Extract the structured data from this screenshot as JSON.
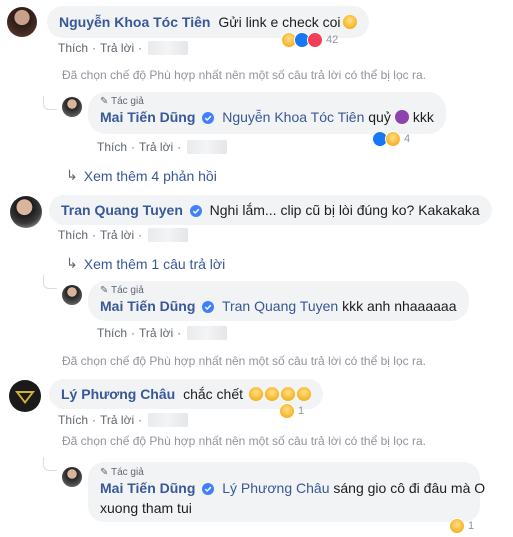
{
  "comments": [
    {
      "author": "Nguyễn Khoa Tóc Tiên",
      "text": "Gửi link e check coi",
      "actions": {
        "like": "Thích",
        "reply": "Trả lời"
      },
      "reaction_count": "42"
    },
    {
      "author": "Tran Quang Tuyen",
      "text": "Nghi lắm... clip cũ bị lòi đúng ko? Kakakaka",
      "actions": {
        "like": "Thích",
        "reply": "Trả lời"
      }
    },
    {
      "author": "Lý Phương Châu",
      "text": "chắc chết",
      "actions": {
        "like": "Thích",
        "reply": "Trả lời"
      },
      "reaction_count": "1"
    }
  ],
  "replies": [
    {
      "badge": "Tác giả",
      "author": "Mai Tiến Dũng",
      "mention": "Nguyễn Khoa Tóc Tiên",
      "text_before_icon": "quỷ",
      "text_after_icon": "kkk",
      "actions": {
        "like": "Thích",
        "reply": "Trả lời"
      },
      "reaction_count": "4"
    },
    {
      "badge": "Tác giả",
      "author": "Mai Tiến Dũng",
      "mention": "Tran Quang Tuyen",
      "text": "kkk anh nhaaaaaa",
      "actions": {
        "like": "Thích",
        "reply": "Trả lời"
      }
    },
    {
      "badge": "Tác giả",
      "author": "Mai Tiến Dũng",
      "mention": "Lý Phương Châu",
      "text_line1": "sáng gio cô đi đâu mà O",
      "text_line2": "xuong tham tui",
      "reaction_count": "1"
    }
  ],
  "filter_notices": [
    "Đã chọn chế độ Phù hợp nhất nên một số câu trả lời có thể bị lọc ra.",
    "Đã chọn chế độ Phù hợp nhất nên một số câu trả lời có thể bị lọc ra.",
    "Đã chọn chế độ Phù hợp nhất nên một số câu trả lời có thể bị lọc ra."
  ],
  "view_more": [
    "Xem thêm 4 phản hồi",
    "Xem thêm 1 câu trả lời"
  ],
  "colors": {
    "link": "#385898",
    "bubble": "#f2f3f5",
    "meta": "#606770",
    "notice": "#90949c"
  },
  "icons": [
    "verified-icon",
    "haha-reaction-icon",
    "like-reaction-icon",
    "love-reaction-icon",
    "reply-arrow-icon",
    "pencil-icon"
  ]
}
